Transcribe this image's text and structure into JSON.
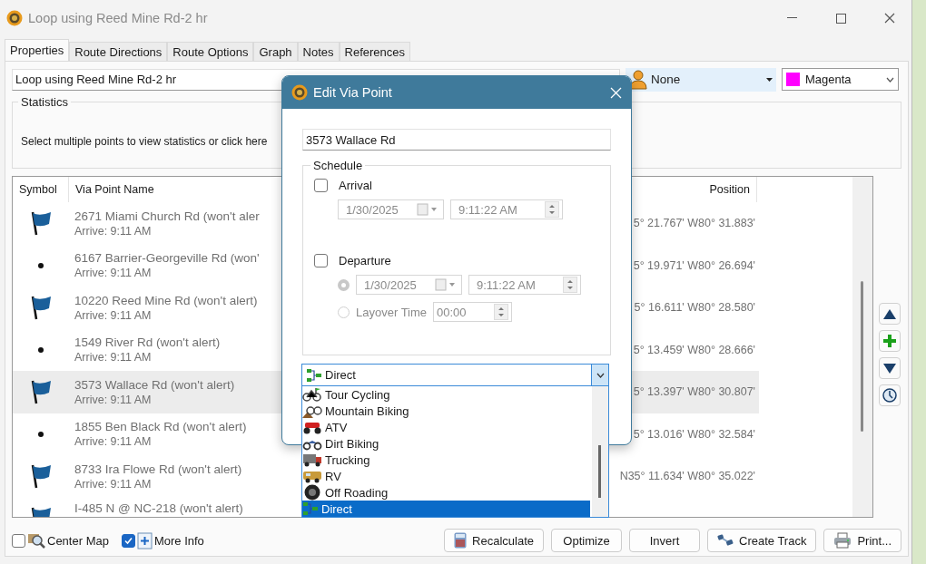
{
  "window": {
    "title": "Loop using Reed Mine Rd-2 hr"
  },
  "tabs": [
    {
      "label": "Properties",
      "selected": true
    },
    {
      "label": "Route Directions",
      "selected": false
    },
    {
      "label": "Route Options",
      "selected": false
    },
    {
      "label": "Graph",
      "selected": false
    },
    {
      "label": "Notes",
      "selected": false
    },
    {
      "label": "References",
      "selected": false
    }
  ],
  "route_name": {
    "value": "Loop using Reed Mine Rd-2 hr"
  },
  "person_dropdown": {
    "value": "None"
  },
  "color_dropdown": {
    "value": "Magenta",
    "color": "#ff00ff"
  },
  "statistics": {
    "title": "Statistics",
    "message": "Select multiple points to view statistics or click here"
  },
  "table": {
    "columns": [
      "Symbol",
      "Via Point Name",
      "Position"
    ],
    "rows": [
      {
        "kind": "flag",
        "name": "2671 Miami Church Rd (won't aler",
        "arrive": "Arrive: 9:11 AM",
        "position": "5° 21.767' W80° 31.883'",
        "selected": false
      },
      {
        "kind": "dot",
        "name": "6167 Barrier-Georgeville Rd (won'",
        "arrive": "Arrive: 9:11 AM",
        "position": "5° 19.971' W80° 26.694'",
        "selected": false
      },
      {
        "kind": "flag",
        "name": "10220 Reed Mine Rd (won't alert)",
        "arrive": "Arrive: 9:11 AM",
        "position": "5° 16.611' W80° 28.580'",
        "selected": false
      },
      {
        "kind": "dot",
        "name": "1549 River Rd (won't alert)",
        "arrive": "Arrive: 9:11 AM",
        "position": "5° 13.459' W80° 28.666'",
        "selected": false
      },
      {
        "kind": "flag",
        "name": "3573 Wallace Rd (won't alert)",
        "arrive": "Arrive: 9:11 AM",
        "position": "5° 13.397' W80° 30.807'",
        "selected": true
      },
      {
        "kind": "dot",
        "name": "1855 Ben Black Rd (won't alert)",
        "arrive": "Arrive: 9:11 AM",
        "position": "5° 13.016' W80° 32.584'",
        "selected": false
      },
      {
        "kind": "flag",
        "name": "8733 Ira Flowe Rd (won't alert)",
        "arrive": "Arrive: 9:11 AM",
        "position": "N35° 11.634' W80° 35.022'",
        "selected": false
      },
      {
        "kind": "flag",
        "name": "I-485 N @ NC-218 (won't alert)",
        "selected": false
      }
    ]
  },
  "options": [
    {
      "kind": "map",
      "label": "Center Map",
      "checked": false
    },
    {
      "kind": "info",
      "label": "More Info",
      "checked": true
    }
  ],
  "buttons": [
    {
      "kind": "calculator",
      "label": "Recalculate"
    },
    {
      "kind": "plain",
      "label": "Optimize"
    },
    {
      "kind": "plain",
      "label": "Invert"
    },
    {
      "kind": "track",
      "label": "Create Track"
    },
    {
      "kind": "printer",
      "label": "Print..."
    }
  ],
  "dialog": {
    "title": "Edit Via Point",
    "name_value": "3573 Wallace Rd",
    "schedule": {
      "title": "Schedule",
      "arrival": {
        "label": "Arrival",
        "checked": false,
        "date": "1/30/2025",
        "time": "9:11:22 AM"
      },
      "departure": {
        "label": "Departure",
        "checked": false,
        "date": "1/30/2025",
        "time": "9:11:22 AM",
        "at_time": {
          "selected": true
        },
        "layover": {
          "label": "Layover Time",
          "value": "00:00",
          "selected": false
        }
      }
    },
    "routing": {
      "value": "Direct",
      "options": [
        {
          "kind": "cycling",
          "label": "Tour Cycling",
          "selected": false
        },
        {
          "kind": "mountain",
          "label": "Mountain Biking",
          "selected": false
        },
        {
          "kind": "atv",
          "label": "ATV",
          "selected": false
        },
        {
          "kind": "dirt",
          "label": "Dirt Biking",
          "selected": false
        },
        {
          "kind": "truck",
          "label": "Trucking",
          "selected": false
        },
        {
          "kind": "rv",
          "label": "RV",
          "selected": false
        },
        {
          "kind": "offroad",
          "label": "Off Roading",
          "selected": false
        },
        {
          "kind": "direct",
          "label": "Direct",
          "selected": true
        }
      ]
    }
  }
}
